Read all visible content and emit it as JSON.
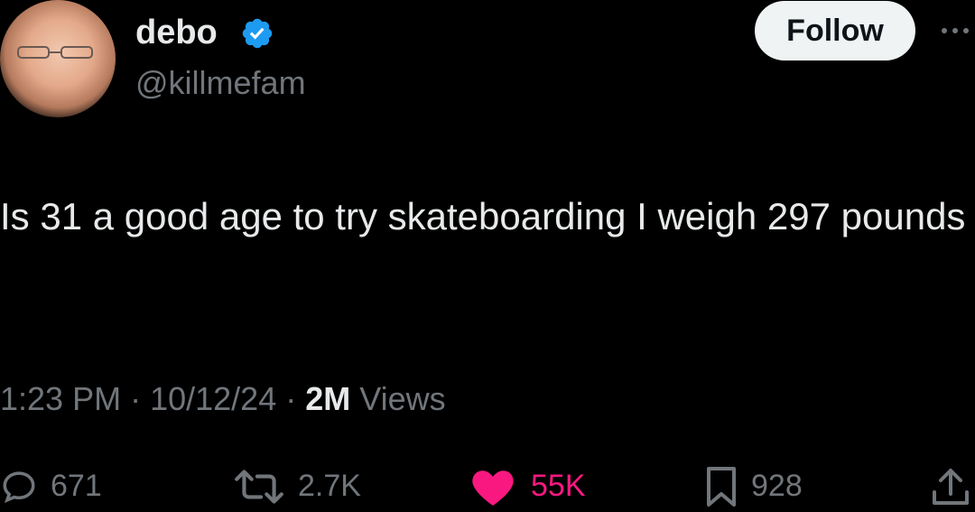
{
  "author": {
    "display_name": "debo",
    "handle": "@killmefam",
    "verified_icon": "verified-badge-icon"
  },
  "header": {
    "follow_label": "Follow",
    "more_icon": "more-icon"
  },
  "tweet": {
    "text": "Is 31 a good age to try skateboarding I weigh 297 pounds"
  },
  "meta": {
    "time": "1:23 PM",
    "separator": " · ",
    "date": "10/12/24",
    "views_count": "2M",
    "views_label": " Views"
  },
  "actions": {
    "replies": "671",
    "reposts": "2.7K",
    "likes": "55K",
    "bookmarks": "928"
  },
  "colors": {
    "background": "#000000",
    "text": "#e7e9ea",
    "muted": "#71767b",
    "like": "#f91880",
    "verified": "#1d9bf0",
    "follow_bg": "#eff3f4"
  }
}
